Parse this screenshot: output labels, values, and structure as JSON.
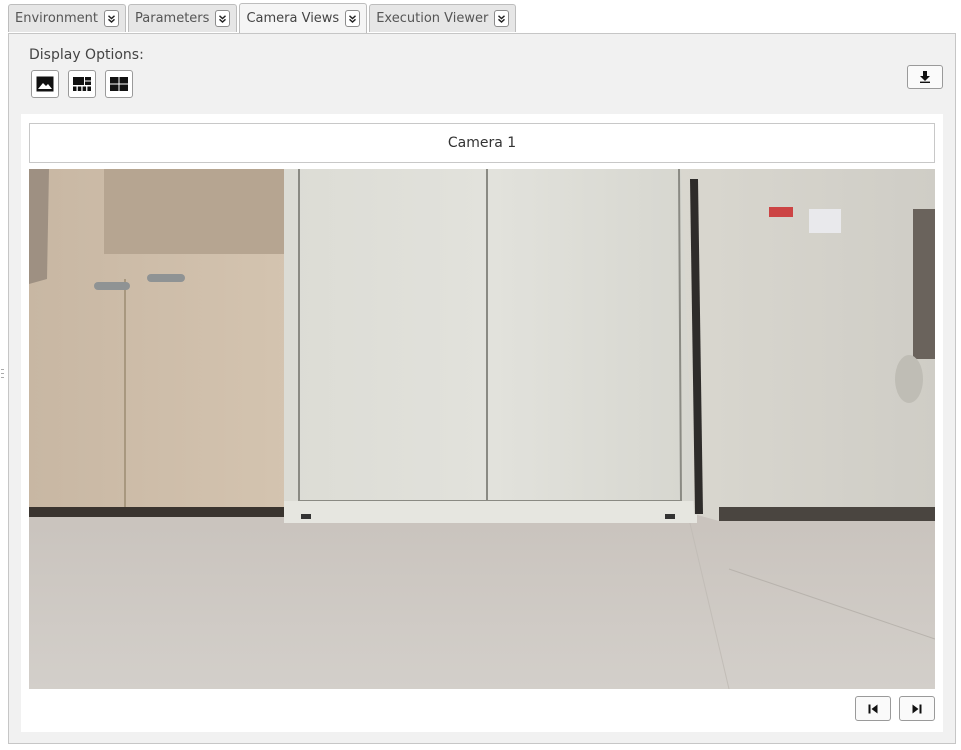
{
  "tabs": [
    {
      "label": "Environment",
      "active": false
    },
    {
      "label": "Parameters",
      "active": false
    },
    {
      "label": "Camera Views",
      "active": true
    },
    {
      "label": "Execution Viewer",
      "active": false
    }
  ],
  "display_options": {
    "label": "Display Options:",
    "buttons": [
      {
        "icon": "image-icon"
      },
      {
        "icon": "filmstrip-grid-icon"
      },
      {
        "icon": "grid-icon"
      }
    ]
  },
  "toolbar": {
    "download_icon": "download-icon"
  },
  "viewer": {
    "camera_title": "Camera 1",
    "nav": {
      "first_icon": "skip-to-start-icon",
      "last_icon": "skip-to-end-icon"
    }
  },
  "colors": {
    "tab_bg": "#e6e6e6",
    "panel_bg": "#f1f1f1",
    "border": "#c6c6c6"
  }
}
